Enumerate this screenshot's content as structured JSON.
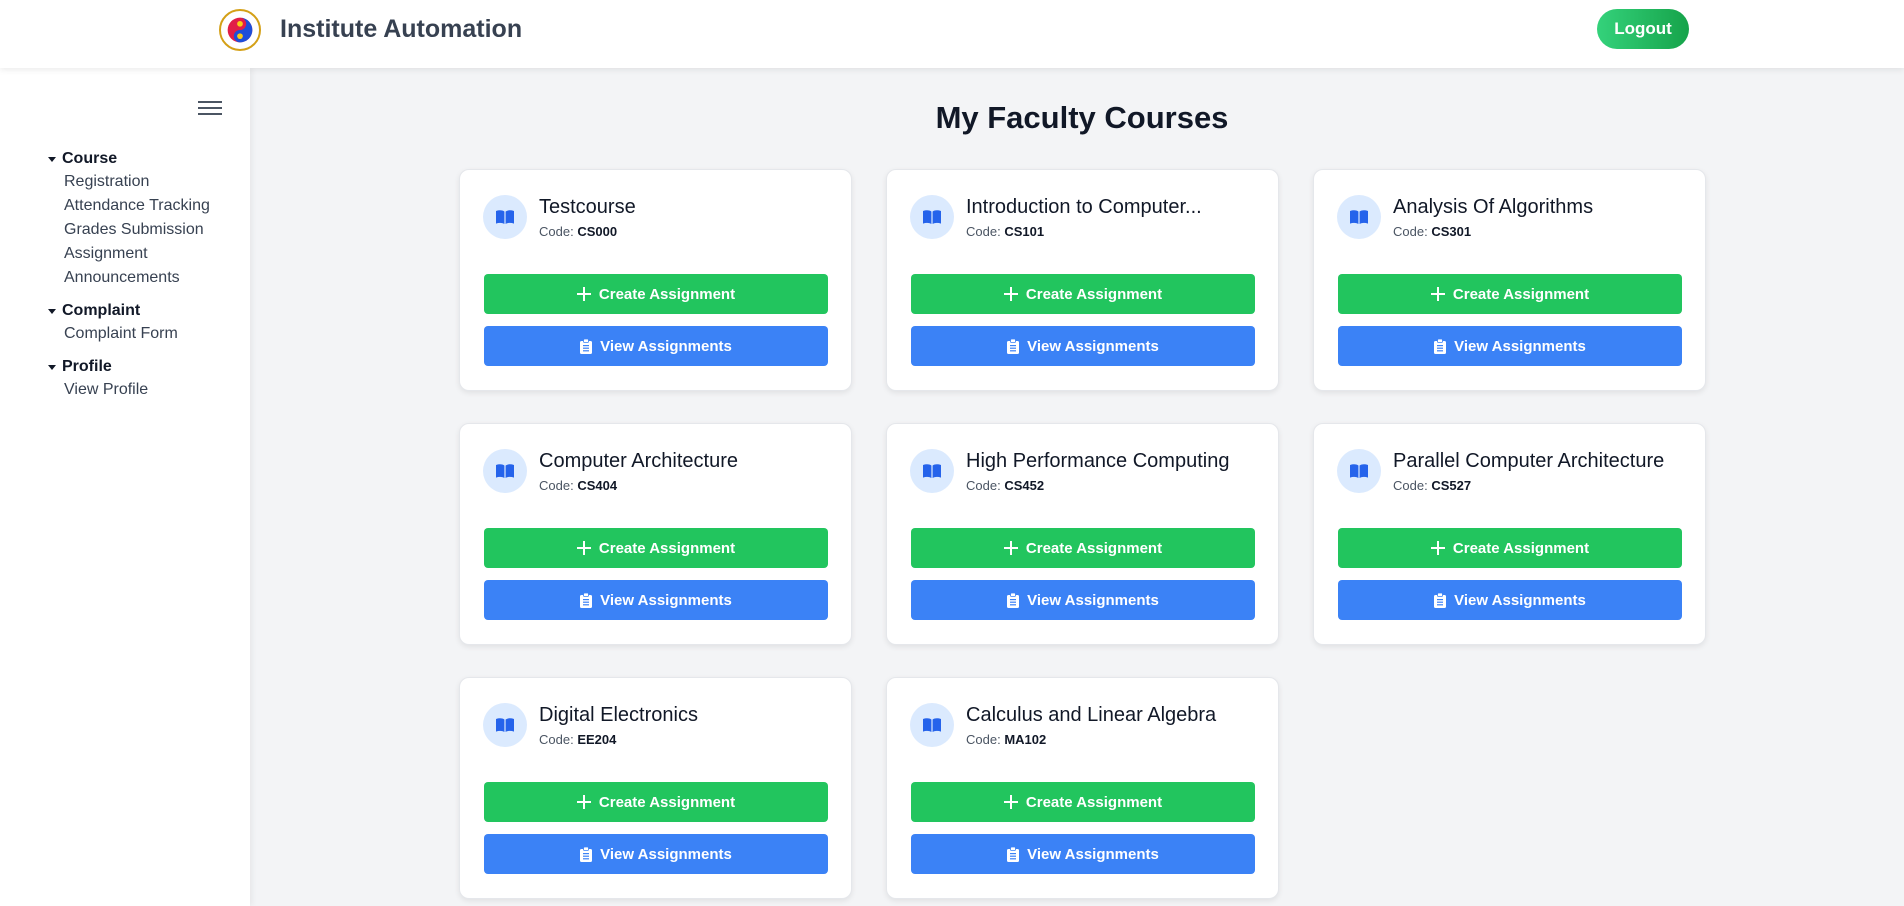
{
  "header": {
    "app_title": "Institute Automation",
    "logout_label": "Logout",
    "logo_icon": "institute-logo-icon"
  },
  "sidebar": {
    "menu_icon": "hamburger-icon",
    "groups": [
      {
        "label": "Course",
        "items": [
          "Registration",
          "Attendance Tracking",
          "Grades Submission",
          "Assignment",
          "Announcements"
        ]
      },
      {
        "label": "Complaint",
        "items": [
          "Complaint Form"
        ]
      },
      {
        "label": "Profile",
        "items": [
          "View Profile"
        ]
      }
    ]
  },
  "main": {
    "page_title": "My Faculty Courses",
    "code_prefix": "Code:",
    "create_label": "Create Assignment",
    "view_label": "View Assignments",
    "course_icon": "book-icon",
    "colors": {
      "create": "#22c55e",
      "view": "#3b82f6",
      "icon_bg": "#dbeafe",
      "icon": "#2563eb"
    },
    "courses": [
      {
        "title": "Testcourse",
        "code": "CS000"
      },
      {
        "title": "Introduction to Computer...",
        "code": "CS101"
      },
      {
        "title": "Analysis Of Algorithms",
        "code": "CS301"
      },
      {
        "title": "Computer Architecture",
        "code": "CS404"
      },
      {
        "title": "High Performance Computing",
        "code": "CS452"
      },
      {
        "title": "Parallel Computer Architecture",
        "code": "CS527"
      },
      {
        "title": "Digital Electronics",
        "code": "EE204"
      },
      {
        "title": "Calculus and Linear Algebra",
        "code": "MA102"
      }
    ]
  }
}
